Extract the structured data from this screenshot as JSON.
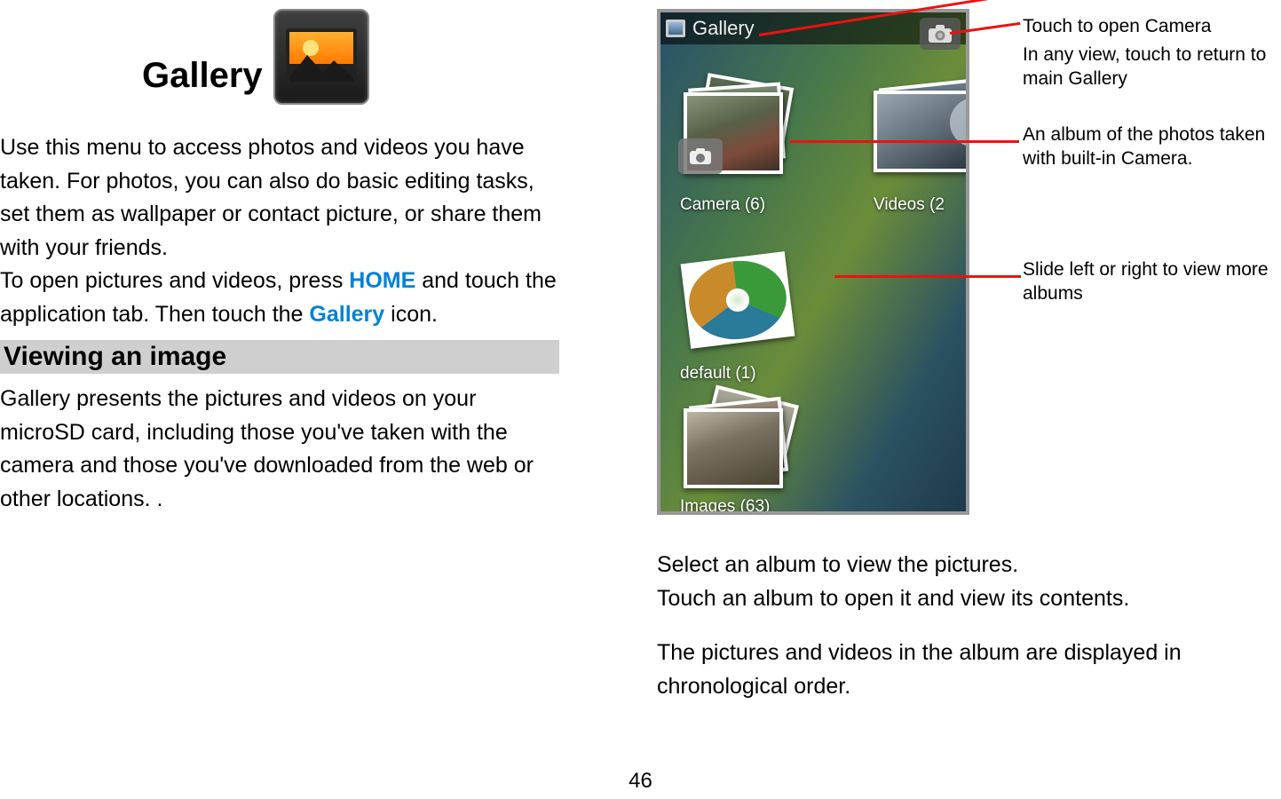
{
  "title": "Gallery",
  "intro_p1_a": "Use this menu to access photos and videos you have taken. For photos, you can also do basic editing tasks, set them as wallpaper or contact picture, or share them with your friends.",
  "intro_p2_pre": "To open pictures and videos, press ",
  "intro_home": "HOME",
  "intro_p2_mid": " and touch the application tab. Then touch the ",
  "intro_gallery": "Gallery",
  "intro_p2_post": " icon.",
  "section1_heading": "Viewing an image",
  "section1_p": "Gallery presents the pictures and videos on your microSD card, including those you've taken with the camera and those you've downloaded from the web or other locations. .",
  "annot_camera": "Touch to open Camera",
  "annot_return": "In any view, touch to return to main Gallery",
  "annot_album": "An album of the photos taken with built-in Camera.",
  "annot_slide": "Slide left or right to view more albums",
  "phone_header": "Gallery",
  "album_camera": "Camera  (6)",
  "album_videos": "Videos  (2",
  "album_default": "default  (1)",
  "album_images": "Images  (63)",
  "right_p1": "Select an album to view the pictures.",
  "right_p2": "Touch an album to open it and view its contents.",
  "right_p3": "The pictures and videos in the album are displayed in chronological order.",
  "page_number": "46"
}
